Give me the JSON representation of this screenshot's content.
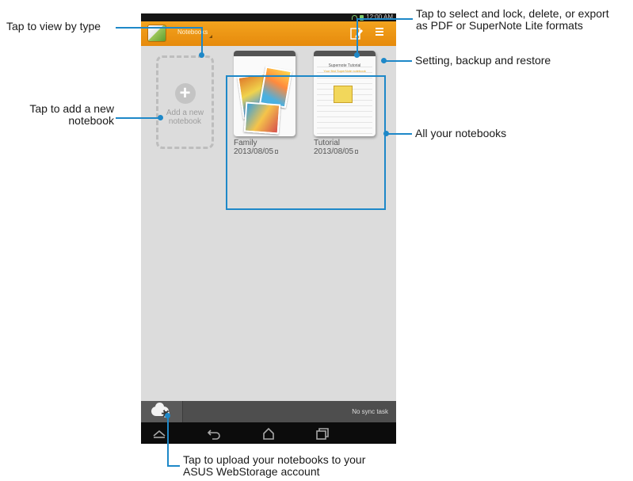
{
  "status_bar": {
    "time": "12:00 AM"
  },
  "app_bar": {
    "view_type_label": "Notebooks",
    "logo_icon": "supernote-logo-icon",
    "edit_icon": "edit-export-icon",
    "menu_icon": "overflow-menu-icon"
  },
  "add_tile": {
    "label_line1": "Add a new",
    "label_line2": "notebook",
    "icon": "plus-icon"
  },
  "notebooks": [
    {
      "name": "Family",
      "date": "2013/08/05"
    },
    {
      "name": "Tutorial",
      "date": "2013/08/05",
      "cover_title": "Supernote Tutorial",
      "cover_subtitle": "Your first SuperNote notebook"
    }
  ],
  "bottom_bar": {
    "sync_status": "No sync task",
    "cloud_icon": "cloud-settings-icon"
  },
  "nav_bar": {
    "back_icon": "back-icon",
    "home_icon": "home-icon",
    "recent_icon": "recent-apps-icon",
    "hide_icon": "hide-keyboard-icon"
  },
  "callouts": {
    "view_by_type": "Tap to view by type",
    "select_lock_line1": "Tap to select and lock, delete, or export",
    "select_lock_line2": "as PDF or SuperNote Lite formats",
    "settings": "Setting, backup and restore",
    "add_notebook_line1": "Tap to add a new",
    "add_notebook_line2": "notebook",
    "all_notebooks": "All your notebooks",
    "upload_line1": "Tap to upload your notebooks to your",
    "upload_line2": "ASUS WebStorage account"
  },
  "colors": {
    "accent": "#1e88c8",
    "app_bar": "#ef9a17"
  }
}
